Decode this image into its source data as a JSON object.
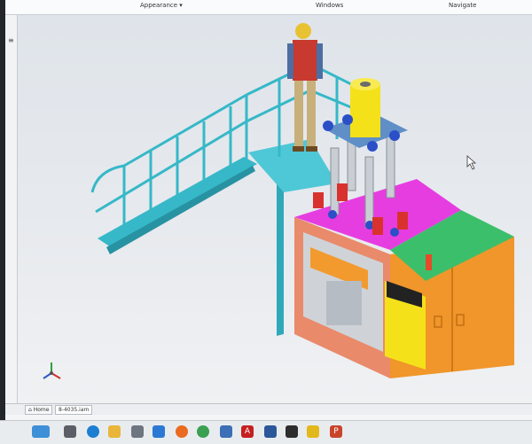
{
  "ribbon": {
    "groups": [
      "Appearance ▾",
      "Windows",
      "Navigate"
    ]
  },
  "tabs": {
    "home": "Home",
    "document": "8-4035.iam"
  },
  "leftstrip": {
    "menu_glyph": "≡"
  },
  "taskbar": {
    "icons": [
      "start-icon",
      "task-view-icon",
      "edge-icon",
      "file-explorer-icon",
      "store-icon",
      "mail-icon",
      "firefox-icon",
      "chrome-icon",
      "app-icon",
      "autocad-icon",
      "word-icon",
      "app-icon-2",
      "app-icon-3",
      "powerpoint-icon"
    ],
    "autocad_letter": "A",
    "powerpoint_letter": "P"
  },
  "colors": {
    "stair": "#36b8c8",
    "press_top": "#e63de0",
    "green_panel": "#3cbf6a",
    "orange_panel": "#f0962a",
    "yellow": "#f5e11a",
    "salmon": "#ea8a62",
    "cylinder_red": "#d9322e",
    "cylinder_blue": "#2a4fc7"
  }
}
